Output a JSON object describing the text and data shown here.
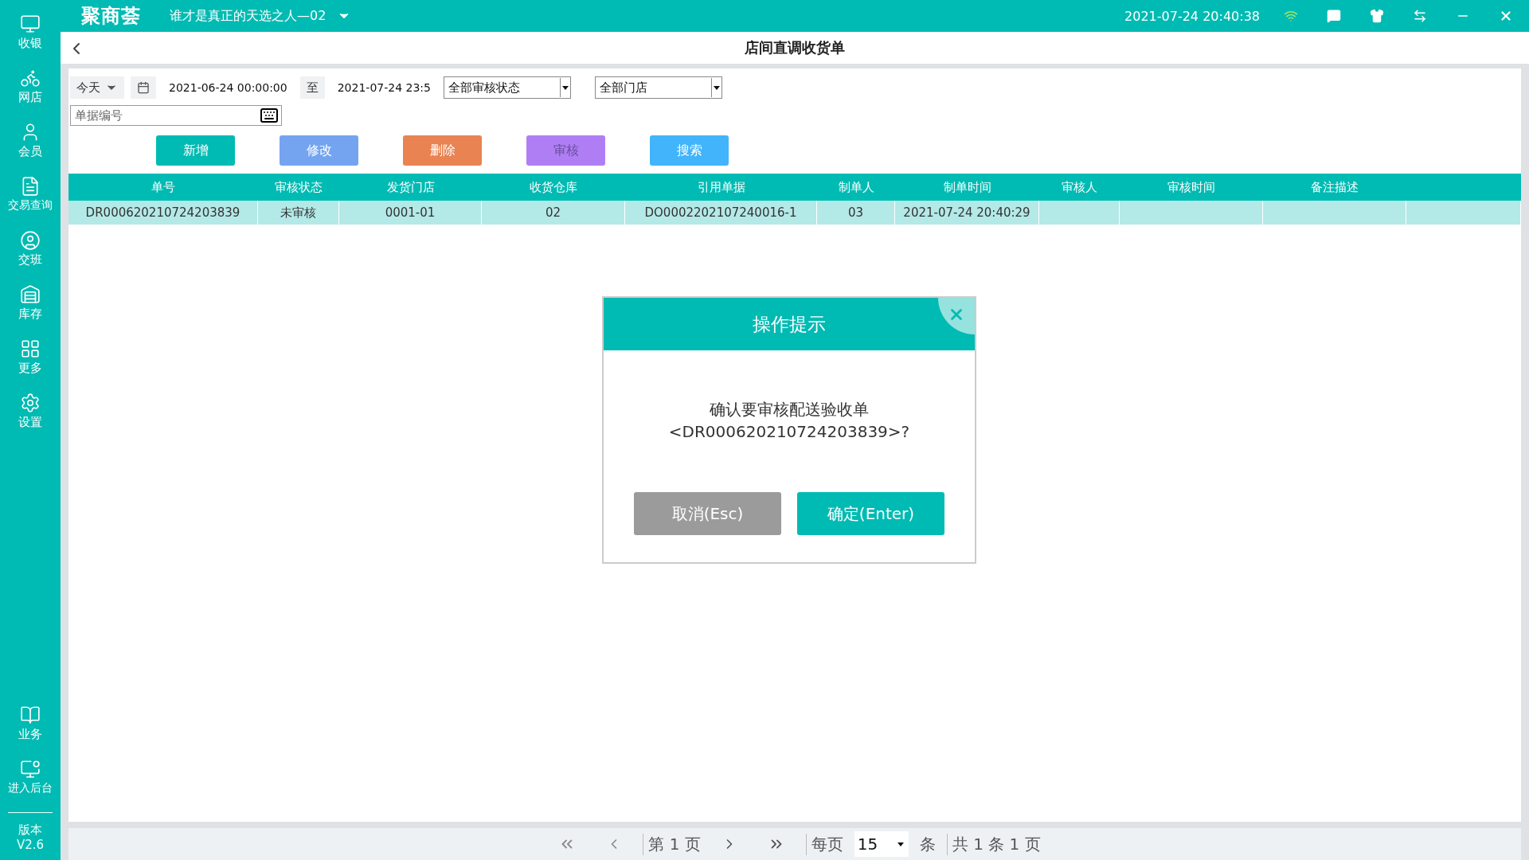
{
  "sidebar": {
    "items": [
      {
        "label": "收银"
      },
      {
        "label": "网店"
      },
      {
        "label": "会员"
      },
      {
        "label": "交易查询"
      },
      {
        "label": "交班"
      },
      {
        "label": "库存"
      },
      {
        "label": "更多"
      },
      {
        "label": "设置"
      }
    ],
    "bottom_items": [
      {
        "label": "业务"
      },
      {
        "label": "进入后台"
      }
    ],
    "version_label": "版本",
    "version": "V2.6"
  },
  "top_bar": {
    "logo": "聚商荟",
    "store": "谁才是真正的天选之人—02",
    "datetime": "2021-07-24 20:40:38"
  },
  "page_title": "店间直调收货单",
  "filters": {
    "period": "今天",
    "date_from": "2021-06-24 00:00:00",
    "to_label": "至",
    "date_to": "2021-07-24 23:5",
    "status": "全部审核状态",
    "store": "全部门店",
    "order_no": {
      "placeholder": "单据编号"
    }
  },
  "buttons": [
    {
      "label": "新增",
      "color": "#00bbb3",
      "disabled": false
    },
    {
      "label": "修改",
      "color": "#74a4f0",
      "disabled": false
    },
    {
      "label": "删除",
      "color": "#e98351",
      "disabled": false
    },
    {
      "label": "审核",
      "color": "#b07ef4",
      "disabled": true
    },
    {
      "label": "搜索",
      "color": "#42b4fb",
      "disabled": false
    }
  ],
  "table": {
    "columns": [
      "单号",
      "审核状态",
      "发货门店",
      "收货仓库",
      "引用单据",
      "制单人",
      "制单时间",
      "审核人",
      "审核时间",
      "备注描述"
    ],
    "rows": [
      {
        "selected": true,
        "cells": [
          "DR000620210724203839",
          "未审核",
          "0001-01",
          "02",
          "DO0002202107240016-1",
          "03",
          "2021-07-24 20:40:29",
          "",
          "",
          ""
        ]
      }
    ]
  },
  "dialog": {
    "title": "操作提示",
    "message_line_1": "确认要审核配送验收单",
    "message_line_2": "<DR000620210724203839>?",
    "cancel": "取消(Esc)",
    "confirm": "确定(Enter)"
  },
  "pagination": {
    "page": "第 1 页",
    "per_page_label": "每页",
    "per_page": "15",
    "per_page_unit": "条",
    "total": "共 1 条 1 页"
  }
}
